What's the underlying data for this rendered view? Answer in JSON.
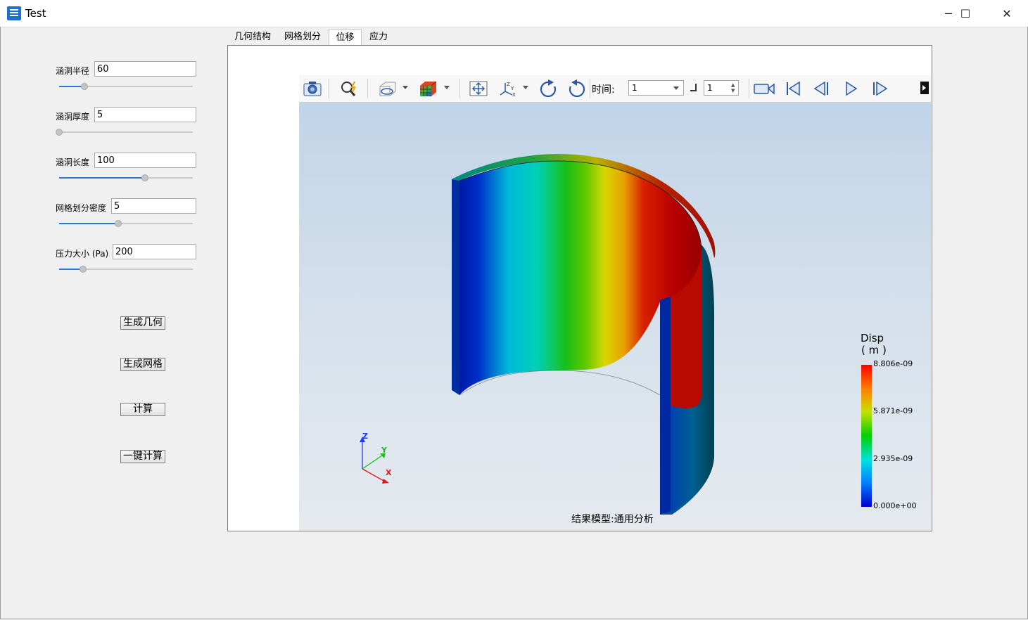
{
  "window": {
    "title": "Test",
    "minimize": "─",
    "maximize": "☐",
    "close": "✕"
  },
  "params": [
    {
      "label": "涵洞半径",
      "value": "60",
      "slider": 0.19
    },
    {
      "label": "涵洞厚度",
      "value": "5",
      "slider": 0.0
    },
    {
      "label": "涵洞长度",
      "value": "100",
      "slider": 0.64
    },
    {
      "label": "网格划分密度",
      "value": "5",
      "slider": 0.44
    },
    {
      "label": "压力大小 (Pa)",
      "value": "200",
      "slider": 0.18
    }
  ],
  "actions": {
    "gen_geometry": "生成几何",
    "gen_mesh": "生成网格",
    "compute": "计算",
    "one_click": "一键计算"
  },
  "tabs": [
    "几何结构",
    "网格划分",
    "位移",
    "应力"
  ],
  "active_tab": 2,
  "toolbar": {
    "time_label": "时间:",
    "time_value": "1",
    "step_value": "1"
  },
  "viewport": {
    "caption": "结果模型:通用分析",
    "legend": {
      "title": "Disp",
      "unit": "( m )",
      "ticks": [
        "8.806e-09",
        "5.871e-09",
        "2.935e-09",
        "0.000e+00"
      ]
    },
    "axes": {
      "z": "Z",
      "y": "Y",
      "x": "X"
    }
  },
  "colors": {
    "accent": "#2b78d6",
    "legend_top": "#ff0000",
    "legend_bottom": "#0000cc"
  }
}
